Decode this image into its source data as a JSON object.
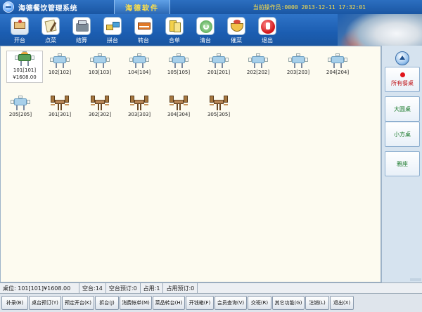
{
  "window": {
    "title": "海德餐饮管理系统",
    "brand": "海德软件",
    "operator_info": "当前操作员:0000 2013-12-11 17:32:01"
  },
  "toolbar": {
    "buttons": [
      {
        "label": "开台",
        "icon": "open-table-icon"
      },
      {
        "label": "点菜",
        "icon": "order-icon"
      },
      {
        "label": "结算",
        "icon": "checkout-icon"
      },
      {
        "label": "拼台",
        "icon": "combine-table-icon"
      },
      {
        "label": "转台",
        "icon": "transfer-table-icon"
      },
      {
        "label": "合单",
        "icon": "merge-bill-icon"
      },
      {
        "label": "清台",
        "icon": "clear-table-icon"
      },
      {
        "label": "催菜",
        "icon": "rush-order-icon"
      },
      {
        "label": "退出",
        "icon": "exit-icon"
      }
    ]
  },
  "tables": [
    {
      "label": "101[101]",
      "amount": "¥1608.00",
      "type": "round",
      "status": "occupied"
    },
    {
      "label": "102[102]",
      "type": "round",
      "status": "free"
    },
    {
      "label": "103[103]",
      "type": "round",
      "status": "free"
    },
    {
      "label": "104[104]",
      "type": "round",
      "status": "free"
    },
    {
      "label": "105[105]",
      "type": "round",
      "status": "free"
    },
    {
      "label": "201[201]",
      "type": "round",
      "status": "free"
    },
    {
      "label": "202[202]",
      "type": "round",
      "status": "free"
    },
    {
      "label": "203[203]",
      "type": "round",
      "status": "free"
    },
    {
      "label": "204[204]",
      "type": "round",
      "status": "free"
    },
    {
      "label": "205[205]",
      "type": "round",
      "status": "free"
    },
    {
      "label": "301[301]",
      "type": "square",
      "status": "free"
    },
    {
      "label": "302[302]",
      "type": "square",
      "status": "free"
    },
    {
      "label": "303[303]",
      "type": "square",
      "status": "free"
    },
    {
      "label": "304[304]",
      "type": "square",
      "status": "free"
    },
    {
      "label": "305[305]",
      "type": "square",
      "status": "free"
    }
  ],
  "sidebar": {
    "categories": [
      {
        "label": "所有餐桌",
        "active": true
      },
      {
        "label": "大圆桌",
        "active": false
      },
      {
        "label": "小方桌",
        "active": false
      },
      {
        "label": "雅座",
        "active": false
      }
    ]
  },
  "status": {
    "current": "桌位: 101[101]¥1608.00",
    "empty": "空台:14",
    "empty_reserved": "空台预订:0",
    "occupied": "占用:1",
    "occupied_reserved": "占用预订:0"
  },
  "bottom": {
    "buttons": [
      "补录(B)",
      "桌台预订(Y)",
      "预定开台(K)",
      "拆台(J)",
      "消费帐单(M)",
      "菜品转台(H)",
      "开钱箱(F)",
      "会员查询(V)",
      "交班(R)",
      "其它功能(G)",
      "注销(L)",
      "退出(X)"
    ]
  },
  "colors": {
    "titlebar": "#1a56a3",
    "brand_text": "#ffe14a",
    "main_bg": "#fdfbf0",
    "sidebar_bg": "#d6e3ef",
    "category_text": "#1b7a2c",
    "category_active_text": "#c0171b"
  }
}
